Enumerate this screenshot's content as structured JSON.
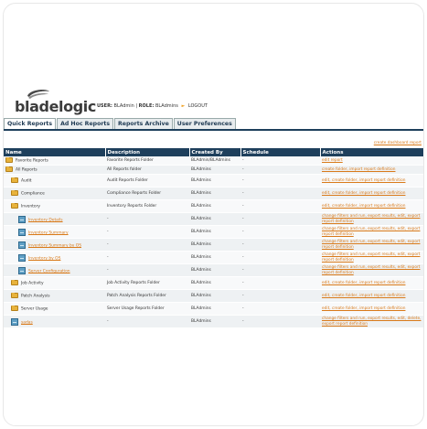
{
  "app": {
    "logo_text": "bladelogic",
    "user_label": "USER:",
    "user_value": "BLAdmin",
    "role_label": "ROLE:",
    "role_value": "BLAdmins",
    "logout": "LOGOUT"
  },
  "tabs": [
    {
      "label": "Quick Reports",
      "active": true
    },
    {
      "label": "Ad Hoc Reports",
      "active": false
    },
    {
      "label": "Reports Archive",
      "active": false
    },
    {
      "label": "User Preferences",
      "active": false
    }
  ],
  "panel": {
    "create_dashboard": "create dashboard report"
  },
  "table": {
    "columns": [
      "Name",
      "Description",
      "Created By",
      "Schedule",
      "Actions"
    ],
    "rows": [
      {
        "indent": 0,
        "icon": "folder-icon",
        "name": "Favorite Reports",
        "link": false,
        "description": "Favorite Reports Folder",
        "created_by": "BLAdmin/BLAdmins",
        "schedule": "-",
        "actions": "edit report"
      },
      {
        "indent": 0,
        "icon": "folder-icon",
        "name": "All Reports",
        "link": false,
        "description": "All Reports folder",
        "created_by": "BLAdmins",
        "schedule": "-",
        "actions": "create folder, import report definition"
      },
      {
        "indent": 1,
        "icon": "folder-icon",
        "name": "Audit",
        "link": false,
        "description": "Audit Reports Folder",
        "created_by": "BLAdmins",
        "schedule": "-",
        "actions": "edit, create folder, import report definition"
      },
      {
        "indent": 1,
        "icon": "folder-icon",
        "name": "Compliance",
        "link": false,
        "description": "Compliance Reports Folder",
        "created_by": "BLAdmins",
        "schedule": "-",
        "actions": "edit, create folder, import report definition"
      },
      {
        "indent": 1,
        "icon": "folder-icon",
        "name": "Inventory",
        "link": false,
        "description": "Inventory Reports Folder",
        "created_by": "BLAdmins",
        "schedule": "-",
        "actions": "edit, create folder, import report definition"
      },
      {
        "indent": 2,
        "icon": "report-icon",
        "name": "Inventory Details",
        "link": true,
        "description": "-",
        "created_by": "BLAdmins",
        "schedule": "-",
        "actions": "change filters and run, export results, edit, export report definition"
      },
      {
        "indent": 2,
        "icon": "report-icon",
        "name": "Inventory Summary",
        "link": true,
        "description": "-",
        "created_by": "BLAdmins",
        "schedule": "-",
        "actions": "change filters and run, export results, edit, export report definition"
      },
      {
        "indent": 2,
        "icon": "report-icon",
        "name": "Inventory Summary by OS",
        "link": true,
        "description": "-",
        "created_by": "BLAdmins",
        "schedule": "-",
        "actions": "change filters and run, export results, edit, export report definition"
      },
      {
        "indent": 2,
        "icon": "report-icon",
        "name": "Inventory by OS",
        "link": true,
        "description": "-",
        "created_by": "BLAdmins",
        "schedule": "-",
        "actions": "change filters and run, export results, edit, export report definition"
      },
      {
        "indent": 2,
        "icon": "report-icon",
        "name": "Server Configuration",
        "link": true,
        "description": "-",
        "created_by": "BLAdmins",
        "schedule": "-",
        "actions": "change filters and run, export results, edit, export report definition"
      },
      {
        "indent": 1,
        "icon": "folder-icon",
        "name": "Job Activity",
        "link": false,
        "description": "Job Activity Reports Folder",
        "created_by": "BLAdmins",
        "schedule": "-",
        "actions": "edit, create folder, import report definition"
      },
      {
        "indent": 1,
        "icon": "folder-icon",
        "name": "Patch Analysis",
        "link": false,
        "description": "Patch Analysis Reports Folder",
        "created_by": "BLAdmins",
        "schedule": "-",
        "actions": "edit, create folder, import report definition"
      },
      {
        "indent": 1,
        "icon": "folder-icon",
        "name": "Server Usage",
        "link": false,
        "description": "Server Usage Reports Folder",
        "created_by": "BLAdmins",
        "schedule": "-",
        "actions": "edit, create folder, import report definition"
      },
      {
        "indent": 1,
        "icon": "report-icon",
        "name": "sadas",
        "link": true,
        "description": "-",
        "created_by": "BLAdmins",
        "schedule": "-",
        "actions": "change filters and run, export results, edit, delete, export report definition"
      }
    ]
  }
}
